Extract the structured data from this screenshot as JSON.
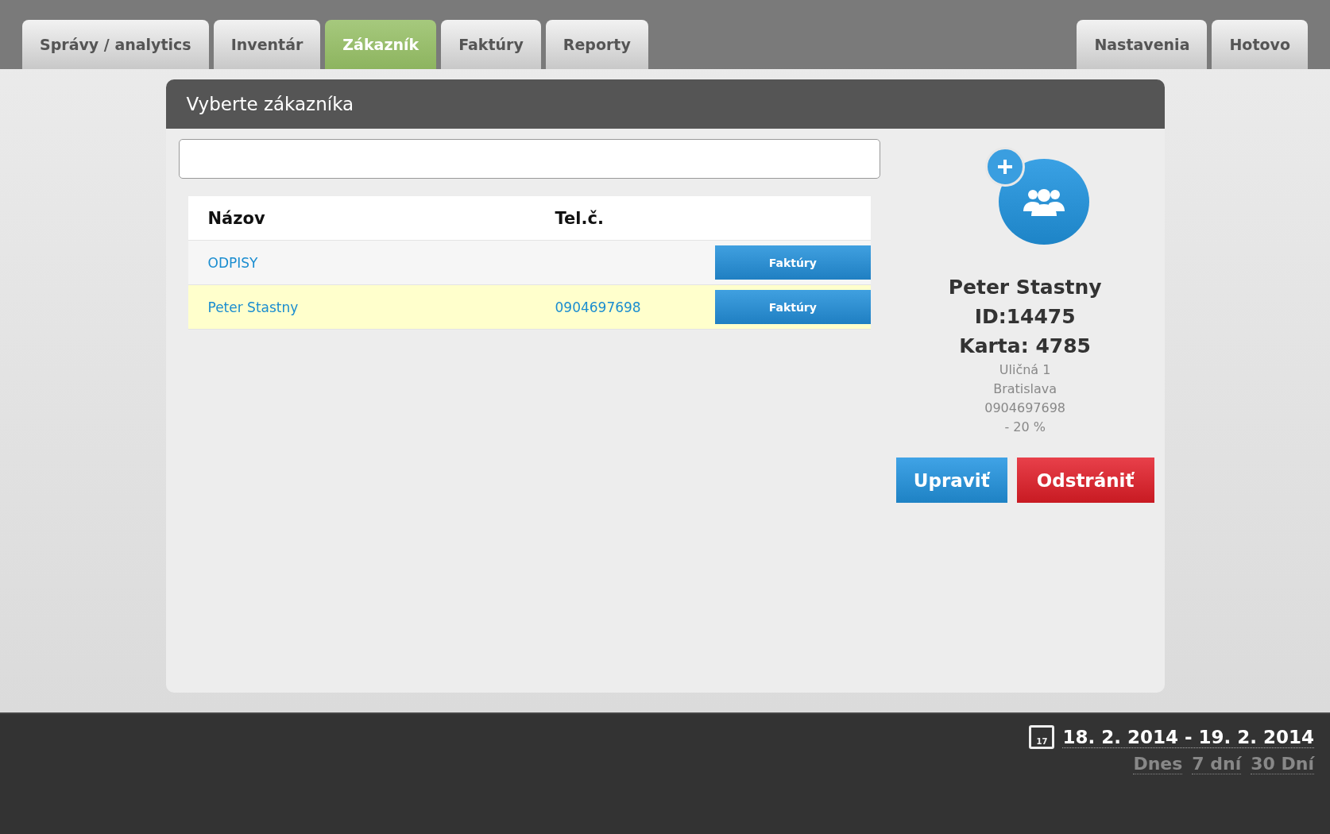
{
  "tabs_left": [
    {
      "label": "Správy / analytics",
      "selected": false
    },
    {
      "label": "Inventár",
      "selected": false
    },
    {
      "label": "Zákazník",
      "selected": true
    },
    {
      "label": "Faktúry",
      "selected": false
    },
    {
      "label": "Reporty",
      "selected": false
    }
  ],
  "tabs_right": [
    {
      "label": "Nastavenia",
      "selected": false
    },
    {
      "label": "Hotovo",
      "selected": false
    }
  ],
  "panel": {
    "title": "Vyberte zákazníka",
    "table": {
      "columns": [
        "Názov",
        "Tel.č."
      ],
      "rows": [
        {
          "name": "ODPISY",
          "button": "Faktúry",
          "selected": false
        },
        {
          "name": "Peter Stastny",
          "phone": "0904697698",
          "button": "Faktúry",
          "selected": true
        }
      ]
    },
    "customer": {
      "name": "Peter Stastny",
      "id": "ID:14475",
      "card": "Karta: 4785",
      "details": [
        "Uličná 1",
        "Bratislava",
        "0904697698",
        "- 20 %"
      ],
      "edit_button": "Upraviť",
      "delete_button": "Odstrániť"
    }
  },
  "footer": {
    "calendar_day": "17",
    "date_range": "18. 2. 2014 - 19. 2. 2014",
    "quick_ranges": [
      "Dnes",
      "7 dní",
      "30 Dní"
    ]
  }
}
